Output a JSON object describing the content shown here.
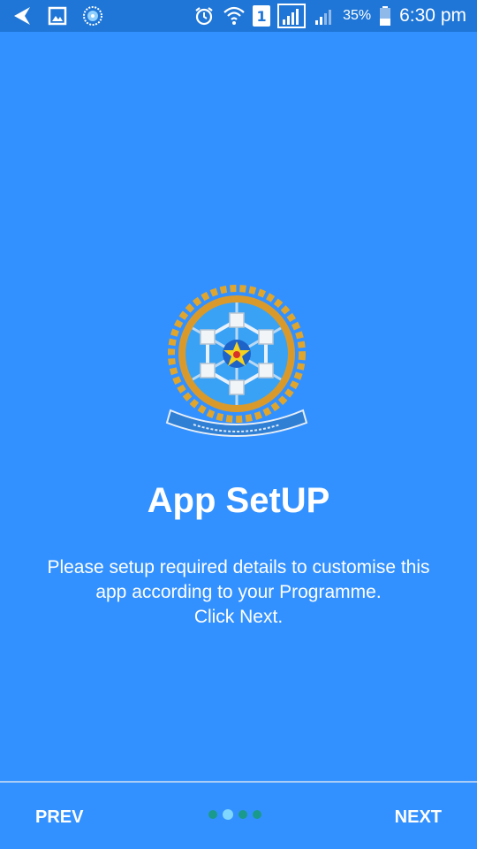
{
  "status_bar": {
    "battery_percent": "35%",
    "time": "6:30 pm",
    "sim_slot": "1",
    "icons": [
      "back-arrow-icon",
      "image-icon",
      "app-logo-icon",
      "alarm-icon",
      "wifi-icon",
      "sim-icon",
      "signal-icon",
      "signal-weak-icon",
      "battery-icon"
    ]
  },
  "main": {
    "logo_icon": "organisation-emblem-icon",
    "title": "App SetUP",
    "description_lines": [
      "Please setup required details to customise this",
      "app according to your Programme.",
      "Click Next."
    ]
  },
  "footer": {
    "prev_label": "PREV",
    "next_label": "NEXT",
    "page_count": 4,
    "active_page": 2
  },
  "colors": {
    "background": "#3391ff",
    "status_bar": "#1f76d6",
    "text": "#ffffff",
    "dot_inactive": "#1a9a8c",
    "dot_active": "#7fd6ff"
  }
}
